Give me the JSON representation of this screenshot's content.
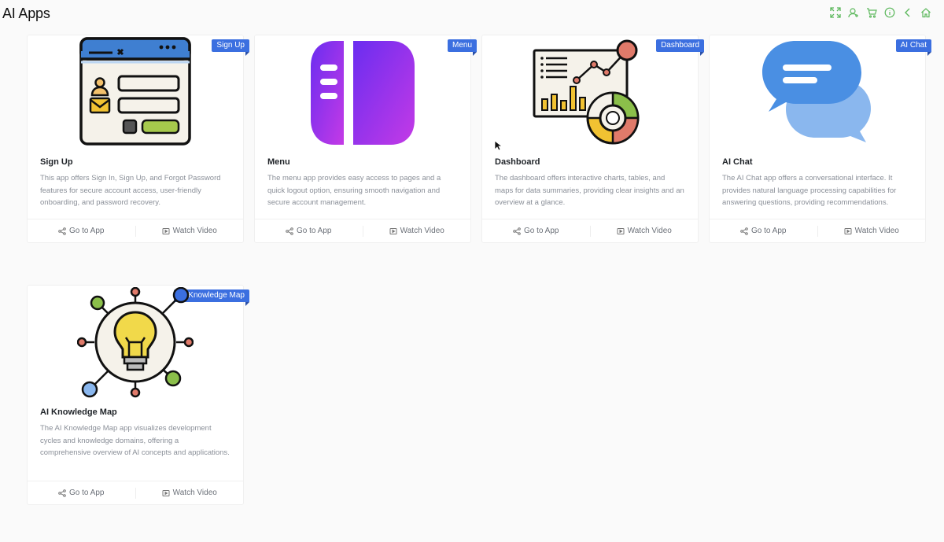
{
  "page": {
    "title": "AI Apps"
  },
  "toolbar": {
    "icons": [
      "fullscreen-icon",
      "user-add-icon",
      "cart-icon",
      "info-icon",
      "back-icon",
      "home-icon"
    ]
  },
  "cards": [
    {
      "ribbon": "Sign Up",
      "title": "Sign Up",
      "description": "This app offers Sign In, Sign Up, and Forgot Password features for secure account access, user-friendly onboarding, and password recovery.",
      "go_label": "Go to App",
      "video_label": "Watch Video"
    },
    {
      "ribbon": "Menu",
      "title": "Menu",
      "description": "The menu app provides easy access to pages and a quick logout option, ensuring smooth navigation and secure account management.",
      "go_label": "Go to App",
      "video_label": "Watch Video"
    },
    {
      "ribbon": "Dashboard",
      "title": "Dashboard",
      "description": "The dashboard offers interactive charts, tables, and maps for data summaries, providing clear insights and an overview at a glance.",
      "go_label": "Go to App",
      "video_label": "Watch Video"
    },
    {
      "ribbon": "AI Chat",
      "title": "AI Chat",
      "description": "The AI Chat app offers a conversational interface. It provides natural language processing capabilities for answering questions, providing recommendations.",
      "go_label": "Go to App",
      "video_label": "Watch Video"
    },
    {
      "ribbon": "AI Knowledge Map",
      "title": "AI Knowledge Map",
      "description": "The AI Knowledge Map app visualizes development cycles and knowledge domains, offering a comprehensive overview of AI concepts and applications.",
      "go_label": "Go to App",
      "video_label": "Watch Video"
    }
  ],
  "colors": {
    "ribbon": "#3b6fe0",
    "toolbar_icon": "#4caf50"
  }
}
